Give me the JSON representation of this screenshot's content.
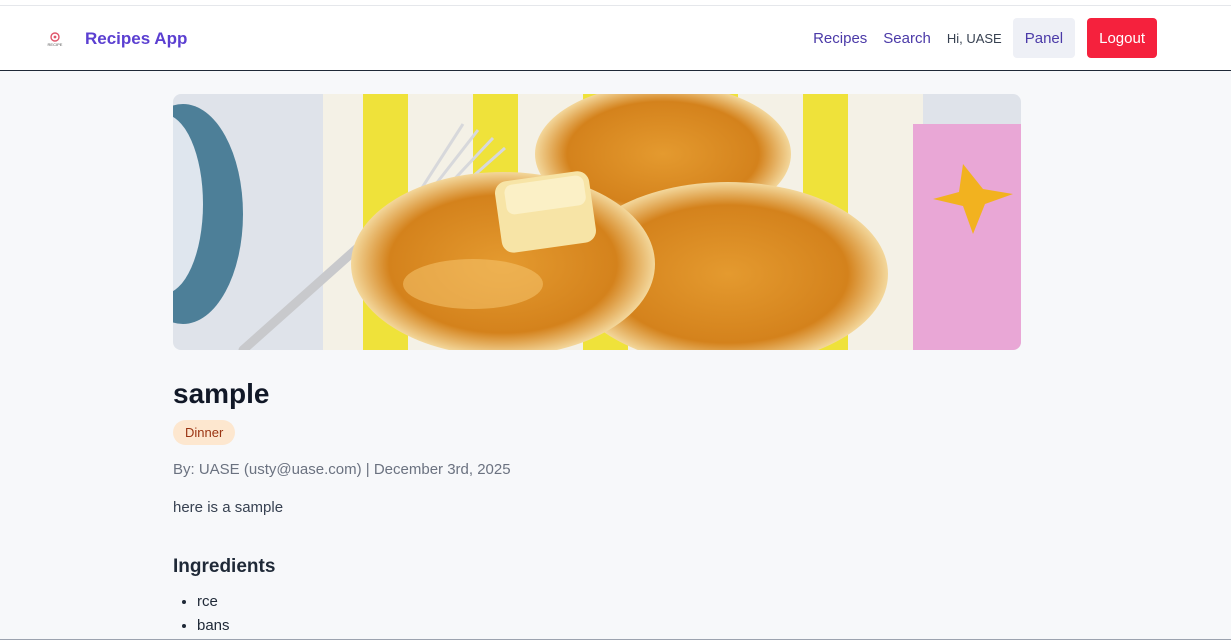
{
  "header": {
    "brand_name": "Recipes App",
    "logo_text": "RECIPE",
    "nav": {
      "recipes": "Recipes",
      "search": "Search",
      "greeting": "Hi, UASE",
      "panel": "Panel",
      "logout": "Logout"
    }
  },
  "recipe": {
    "title": "sample",
    "category": "Dinner",
    "byline": "By: UASE (usty@uase.com) | December 3rd, 2025",
    "description": "here is a sample",
    "ingredients_heading": "Ingredients",
    "ingredients": [
      "rce",
      "bans"
    ]
  },
  "colors": {
    "brand": "#5b3fd1",
    "logout": "#f5213d",
    "badge_bg": "#fde7cf",
    "page_bg": "#f7f8fa"
  }
}
